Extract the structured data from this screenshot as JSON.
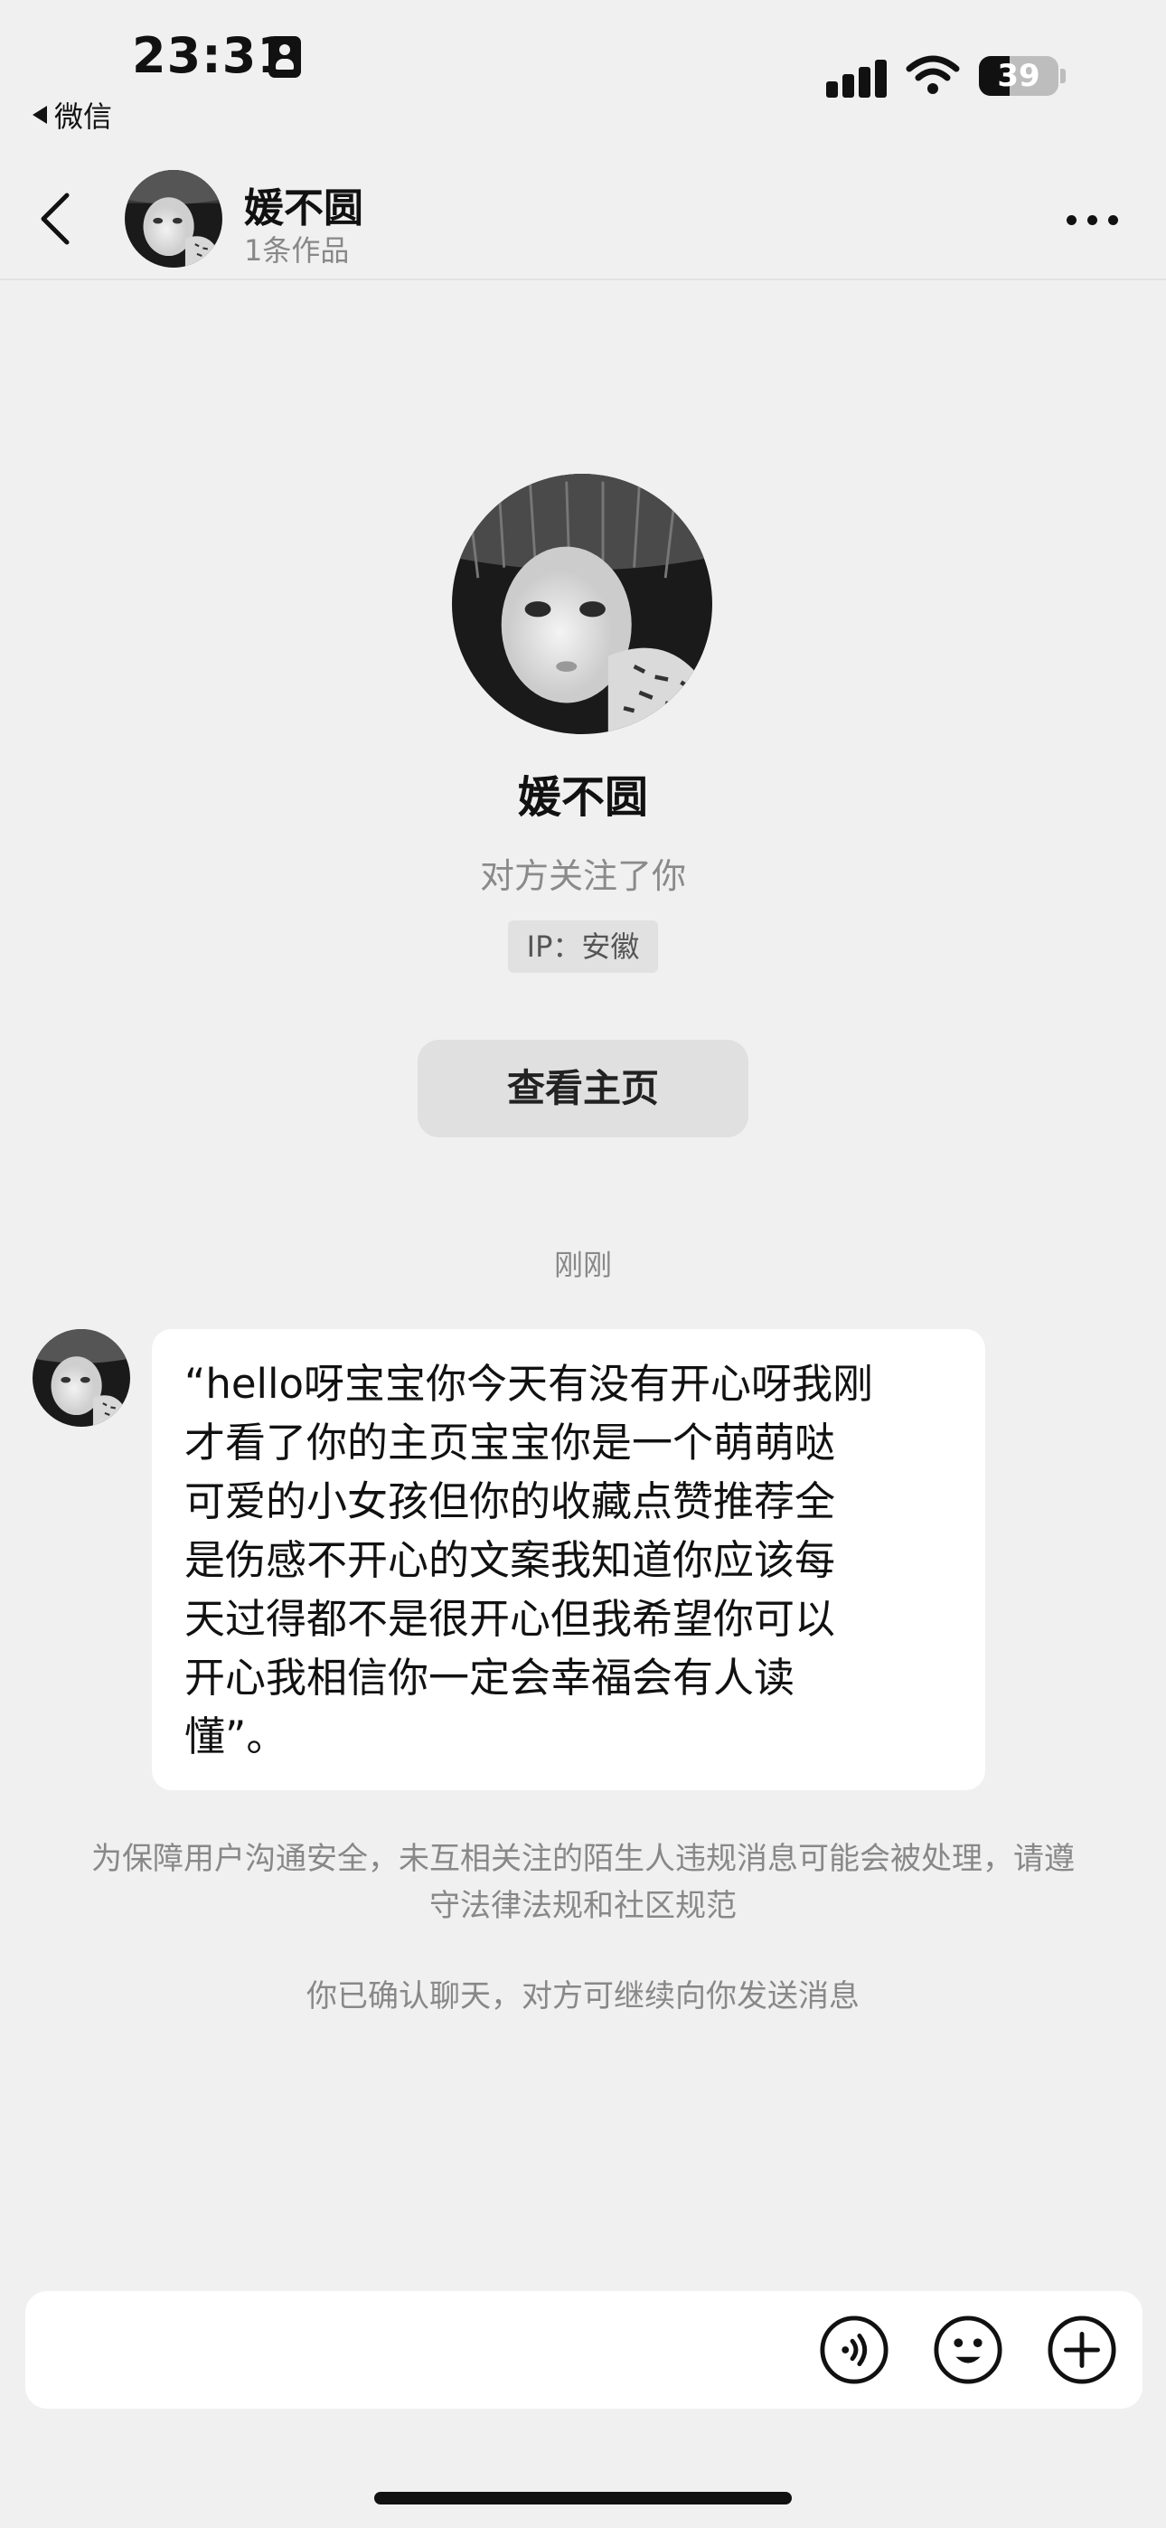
{
  "status_bar": {
    "time": "23:31",
    "back_app": "微信",
    "battery": "39",
    "battery_level": 0.39
  },
  "header": {
    "name": "媛不圆",
    "subtitle": "1条作品"
  },
  "profile": {
    "name": "媛不圆",
    "follow_status": "对方关注了你",
    "ip_location": "IP：安徽",
    "view_home_label": "查看主页"
  },
  "chat": {
    "time_label": "刚刚",
    "message": {
      "lines": [
        "“hello呀宝宝你今天有没有开心呀我刚",
        "才看了你的主页宝宝你是一个萌萌哒",
        "可爱的小女孩但你的收藏点赞推荐全",
        "是伤感不开心的文案我知道你应该每",
        "天过得都不是很开心但我希望你可以",
        "开心我相信你一定会幸福会有人读",
        "懂”。"
      ]
    },
    "safety_notice": "为保障用户沟通安全，未互相关注的陌生人违规消息可能会被处理，请遵守法律法规和社区规范",
    "confirm_note": "你已确认聊天，对方可继续向你发送消息"
  },
  "input_bar": {
    "placeholder": "",
    "icons": [
      "voice-icon",
      "emoji-icon",
      "plus-icon"
    ]
  }
}
